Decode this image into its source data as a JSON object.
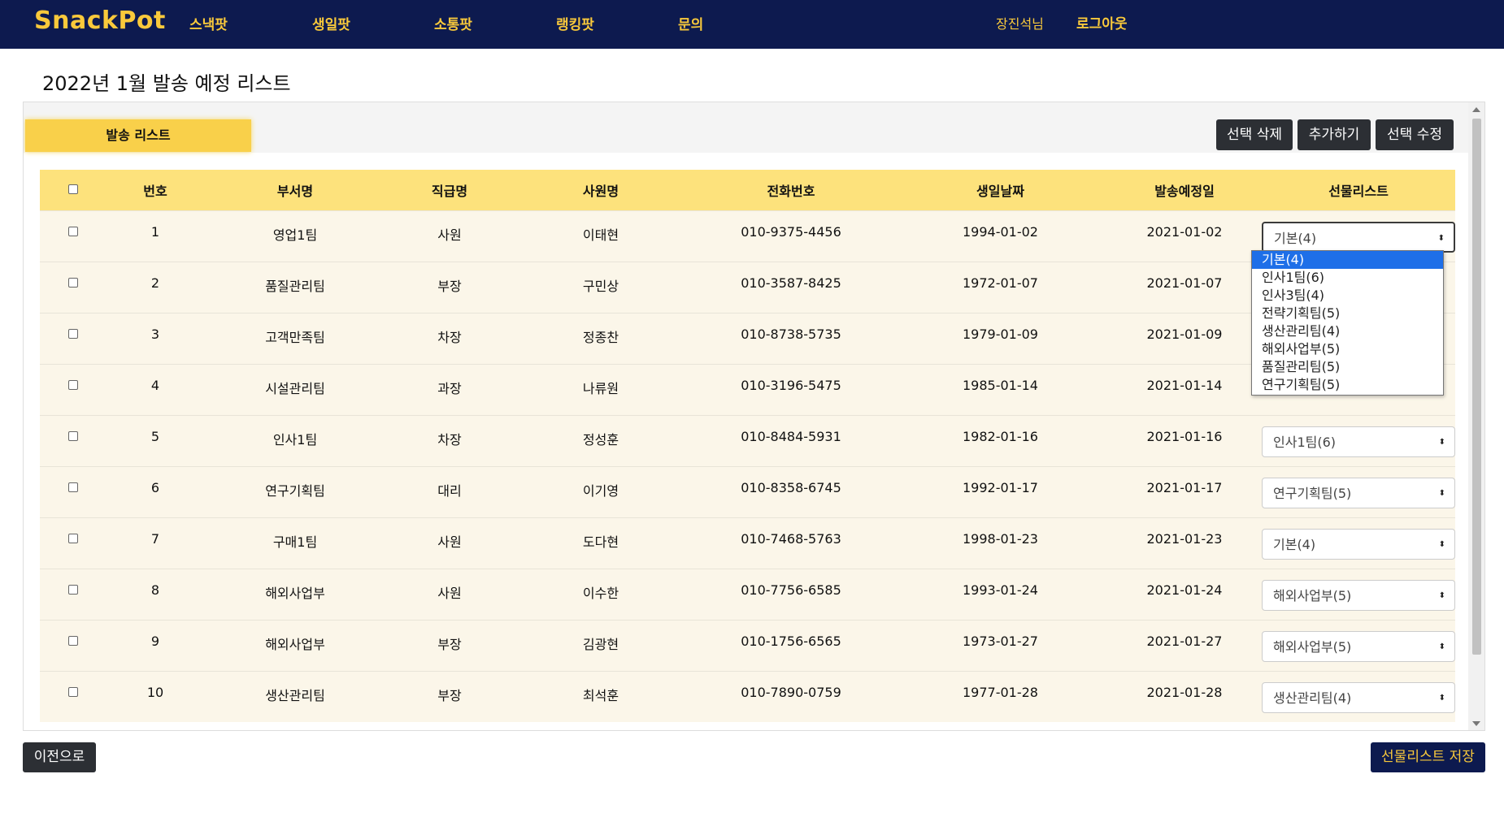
{
  "nav": {
    "brand": "SnackPot",
    "links": [
      "스낵팟",
      "생일팟",
      "소통팟",
      "랭킹팟",
      "문의"
    ],
    "user": "장진석님",
    "logout": "로그아웃"
  },
  "page": {
    "title": "2022년 1월 발송 예정 리스트"
  },
  "panel": {
    "tab_label": "발송 리스트",
    "delete_button": "선택 삭제",
    "add_button": "추가하기",
    "edit_button": "선택 수정"
  },
  "table": {
    "headers": [
      "번호",
      "부서명",
      "직급명",
      "사원명",
      "전화번호",
      "생일날짜",
      "발송예정일",
      "선물리스트"
    ],
    "rows": [
      {
        "no": "1",
        "dept": "영업1팀",
        "rank": "사원",
        "name": "이태현",
        "phone": "010-9375-4456",
        "birth": "1994-01-02",
        "send": "2021-01-02",
        "gift": "기본(4)"
      },
      {
        "no": "2",
        "dept": "품질관리팀",
        "rank": "부장",
        "name": "구민상",
        "phone": "010-3587-8425",
        "birth": "1972-01-07",
        "send": "2021-01-07",
        "gift": ""
      },
      {
        "no": "3",
        "dept": "고객만족팀",
        "rank": "차장",
        "name": "정종찬",
        "phone": "010-8738-5735",
        "birth": "1979-01-09",
        "send": "2021-01-09",
        "gift": ""
      },
      {
        "no": "4",
        "dept": "시설관리팀",
        "rank": "과장",
        "name": "나류원",
        "phone": "010-3196-5475",
        "birth": "1985-01-14",
        "send": "2021-01-14",
        "gift": ""
      },
      {
        "no": "5",
        "dept": "인사1팀",
        "rank": "차장",
        "name": "정성훈",
        "phone": "010-8484-5931",
        "birth": "1982-01-16",
        "send": "2021-01-16",
        "gift": "인사1팀(6)"
      },
      {
        "no": "6",
        "dept": "연구기획팀",
        "rank": "대리",
        "name": "이기영",
        "phone": "010-8358-6745",
        "birth": "1992-01-17",
        "send": "2021-01-17",
        "gift": "연구기획팀(5)"
      },
      {
        "no": "7",
        "dept": "구매1팀",
        "rank": "사원",
        "name": "도다현",
        "phone": "010-7468-5763",
        "birth": "1998-01-23",
        "send": "2021-01-23",
        "gift": "기본(4)"
      },
      {
        "no": "8",
        "dept": "해외사업부",
        "rank": "사원",
        "name": "이수한",
        "phone": "010-7756-6585",
        "birth": "1993-01-24",
        "send": "2021-01-24",
        "gift": "해외사업부(5)"
      },
      {
        "no": "9",
        "dept": "해외사업부",
        "rank": "부장",
        "name": "김광현",
        "phone": "010-1756-6565",
        "birth": "1973-01-27",
        "send": "2021-01-27",
        "gift": "해외사업부(5)"
      },
      {
        "no": "10",
        "dept": "생산관리팀",
        "rank": "부장",
        "name": "최석훈",
        "phone": "010-7890-0759",
        "birth": "1977-01-28",
        "send": "2021-01-28",
        "gift": "생산관리팀(4)"
      }
    ]
  },
  "dropdown": {
    "options": [
      "기본(4)",
      "인사1팀(6)",
      "인사3팀(4)",
      "전략기획팀(5)",
      "생산관리팀(4)",
      "해외사업부(5)",
      "품질관리팀(5)",
      "연구기획팀(5)"
    ],
    "selected_index": 0
  },
  "footer": {
    "prev_button": "이전으로",
    "save_button": "선물리스트 저장"
  },
  "colors": {
    "navy": "#0d1a4f",
    "gold": "#f9c93b",
    "header_yellow": "#fde27c",
    "row_bg": "#fbf6e9",
    "dark_button": "#2c2f34",
    "selection_blue": "#1e6fe8"
  }
}
